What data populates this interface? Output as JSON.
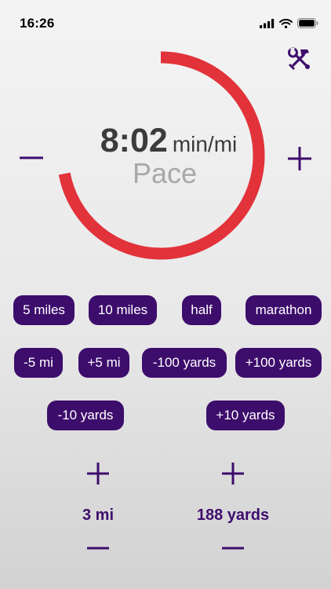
{
  "status_bar": {
    "time": "16:26",
    "icons": [
      "signal-icon",
      "wifi-icon",
      "battery-icon"
    ]
  },
  "header": {
    "tools_icon": "hammer-wrench-icon"
  },
  "pace": {
    "value": "8:02",
    "unit": "min/mi",
    "label": "Pace",
    "ring_fill_fraction": 0.72,
    "ring_color": "#e2323a",
    "decrement_symbol": "−",
    "increment_symbol": "+"
  },
  "presets": {
    "row1": [
      "5 miles",
      "10 miles",
      "half",
      "marathon"
    ],
    "row2": [
      "-5 mi",
      "+5 mi",
      "-100 yards",
      "+100 yards"
    ],
    "row3": [
      "-10 yards",
      "+10 yards"
    ]
  },
  "distance_miles": {
    "value": "3 mi",
    "increment_symbol": "+",
    "decrement_symbol": "−"
  },
  "distance_yards": {
    "value": "188 yards",
    "increment_symbol": "+",
    "decrement_symbol": "−"
  },
  "colors": {
    "accent": "#3d0d6c",
    "ring": "#e2323a",
    "pace_text": "#3b3b3b",
    "label_text": "#a8a8a8"
  }
}
